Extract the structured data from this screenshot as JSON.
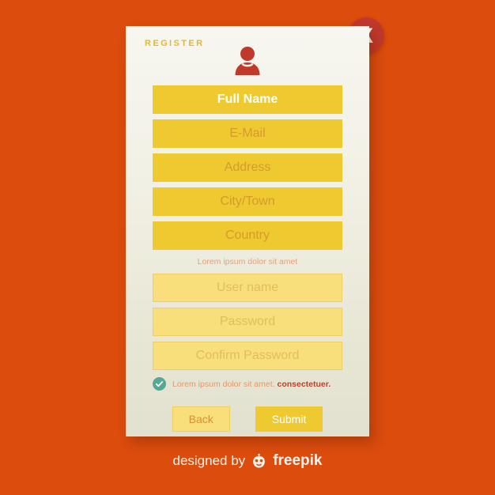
{
  "page": {
    "background_color": "#db4c0d"
  },
  "card": {
    "title": "REGISTER",
    "avatar_icon": "user-avatar-icon",
    "accent_color": "#efc930",
    "surface_color": "#f2f1e6"
  },
  "close_button": {
    "label": "X",
    "icon": "close-icon",
    "color": "#c0392b"
  },
  "primary_fields": [
    {
      "name": "full-name",
      "value": "Full Name",
      "filled": true
    },
    {
      "name": "email",
      "value": "E-Mail",
      "filled": false
    },
    {
      "name": "address",
      "value": "Address",
      "filled": false
    },
    {
      "name": "city-town",
      "value": "City/Town",
      "filled": false
    },
    {
      "name": "country",
      "value": "Country",
      "filled": false
    }
  ],
  "section_note": "Lorem ipsum dolor sit amet",
  "credential_fields": [
    {
      "name": "user-name",
      "value": "User name"
    },
    {
      "name": "password",
      "value": "Password"
    },
    {
      "name": "confirm-password",
      "value": "Confirm Password"
    }
  ],
  "terms": {
    "checked": true,
    "checkmark": "✓",
    "text": "Lorem ipsum dolor sit amet.",
    "emphasis": "consectetuer.",
    "check_color": "#53a995"
  },
  "buttons": {
    "back_label": "Back",
    "submit_label": "Submit"
  },
  "footer": {
    "credit_text": "designed by",
    "brand": "freepik",
    "logo_icon": "freepik-mascot-icon"
  }
}
